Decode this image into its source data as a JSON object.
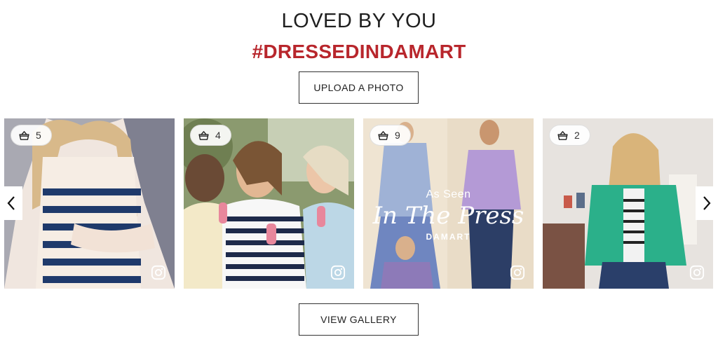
{
  "section": {
    "title": "LOVED BY YOU",
    "hashtag": "#DRESSEDINDAMART",
    "upload_label": "UPLOAD A PHOTO",
    "view_gallery_label": "VIEW GALLERY"
  },
  "colors": {
    "hashtag": "#b8262c",
    "button_border": "#333333"
  },
  "icons": {
    "badge": "basket-icon",
    "corner": "instagram-icon",
    "prev": "chevron-left-icon",
    "next": "chevron-right-icon"
  },
  "tiles": [
    {
      "product_count": "5"
    },
    {
      "product_count": "4"
    },
    {
      "product_count": "9",
      "overlay_line1": "As Seen",
      "overlay_line2": "In The Press",
      "overlay_brand": "DAMART"
    },
    {
      "product_count": "2"
    }
  ]
}
